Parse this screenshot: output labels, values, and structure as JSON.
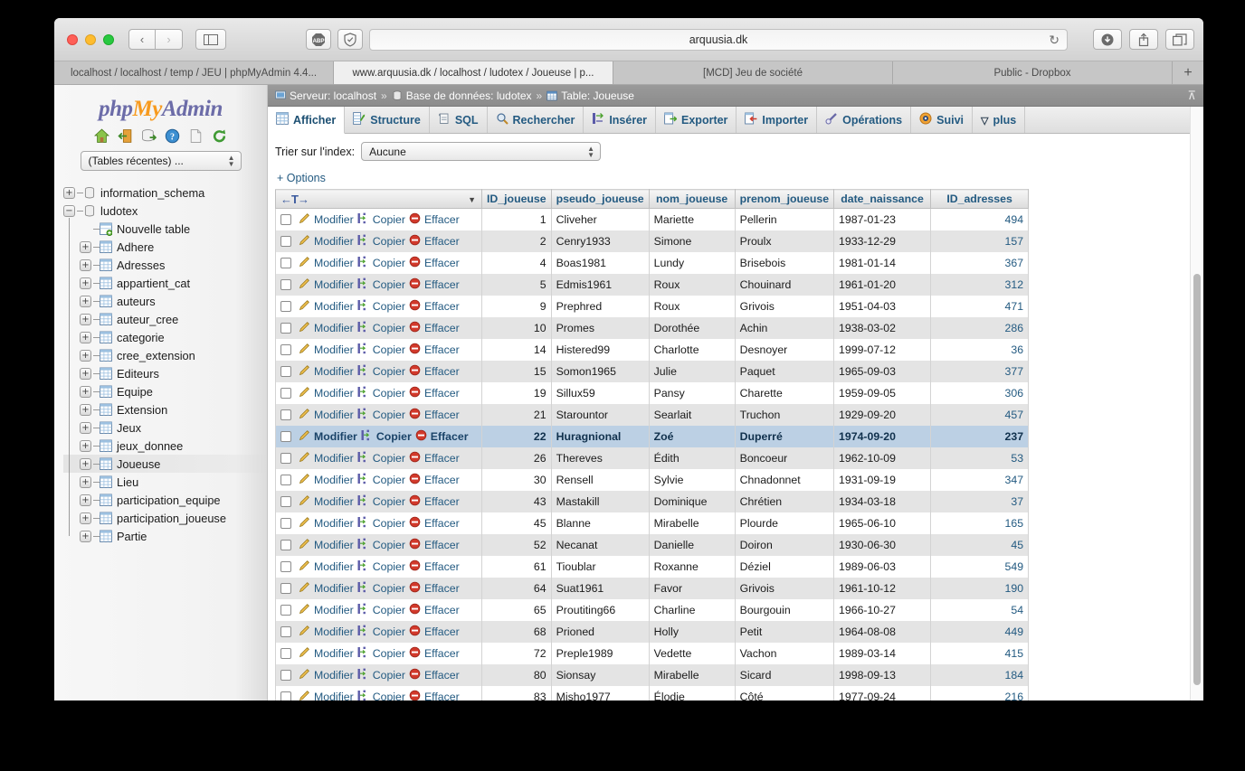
{
  "browser": {
    "address": "arquusia.dk",
    "reload_glyph": "↻",
    "back_glyph": "‹",
    "forward_glyph": "›",
    "sidebar_glyph": "▢",
    "abp_label": "ABP",
    "tabs": [
      {
        "label": "localhost / localhost / temp / JEU | phpMyAdmin 4.4...",
        "active": false
      },
      {
        "label": "www.arquusia.dk / localhost / ludotex / Joueuse | p...",
        "active": true
      },
      {
        "label": "[MCD] Jeu de société",
        "active": false
      },
      {
        "label": "Public - Dropbox",
        "active": false
      }
    ],
    "new_tab_glyph": "+"
  },
  "sidebar": {
    "logo": {
      "php": "php",
      "my": "My",
      "admin": "Admin"
    },
    "icons": [
      "home-icon",
      "logout-icon",
      "export-database-icon",
      "help-icon",
      "documentation-icon",
      "reload-icon"
    ],
    "recent_tables_label": "(Tables récentes) ...",
    "tree": [
      {
        "label": "information_schema",
        "type": "database",
        "expander": "+",
        "indent": 0,
        "selected": false
      },
      {
        "label": "ludotex",
        "type": "database",
        "expander": "−",
        "indent": 0,
        "selected": false
      },
      {
        "label": "Nouvelle table",
        "type": "new-table",
        "expander": "",
        "indent": 1,
        "selected": false
      },
      {
        "label": "Adhere",
        "type": "table",
        "expander": "+",
        "indent": 1,
        "selected": false
      },
      {
        "label": "Adresses",
        "type": "table",
        "expander": "+",
        "indent": 1,
        "selected": false
      },
      {
        "label": "appartient_cat",
        "type": "table",
        "expander": "+",
        "indent": 1,
        "selected": false
      },
      {
        "label": "auteurs",
        "type": "table",
        "expander": "+",
        "indent": 1,
        "selected": false
      },
      {
        "label": "auteur_cree",
        "type": "table",
        "expander": "+",
        "indent": 1,
        "selected": false
      },
      {
        "label": "categorie",
        "type": "table",
        "expander": "+",
        "indent": 1,
        "selected": false
      },
      {
        "label": "cree_extension",
        "type": "table",
        "expander": "+",
        "indent": 1,
        "selected": false
      },
      {
        "label": "Editeurs",
        "type": "table",
        "expander": "+",
        "indent": 1,
        "selected": false
      },
      {
        "label": "Equipe",
        "type": "table",
        "expander": "+",
        "indent": 1,
        "selected": false
      },
      {
        "label": "Extension",
        "type": "table",
        "expander": "+",
        "indent": 1,
        "selected": false
      },
      {
        "label": "Jeux",
        "type": "table",
        "expander": "+",
        "indent": 1,
        "selected": false
      },
      {
        "label": "jeux_donnee",
        "type": "table",
        "expander": "+",
        "indent": 1,
        "selected": false
      },
      {
        "label": "Joueuse",
        "type": "table",
        "expander": "+",
        "indent": 1,
        "selected": true
      },
      {
        "label": "Lieu",
        "type": "table",
        "expander": "+",
        "indent": 1,
        "selected": false
      },
      {
        "label": "participation_equipe",
        "type": "table",
        "expander": "+",
        "indent": 1,
        "selected": false
      },
      {
        "label": "participation_joueuse",
        "type": "table",
        "expander": "+",
        "indent": 1,
        "selected": false
      },
      {
        "label": "Partie",
        "type": "table",
        "expander": "+",
        "indent": 1,
        "selected": false
      }
    ]
  },
  "breadcrumb": {
    "server_label": "Serveur: localhost",
    "database_label": "Base de données: ludotex",
    "table_label": "Table: Joueuse",
    "separator": "»",
    "collapse_glyph": "⊼"
  },
  "navtabs": [
    {
      "label": "Afficher",
      "icon": "browse-icon",
      "active": true
    },
    {
      "label": "Structure",
      "icon": "structure-icon",
      "active": false
    },
    {
      "label": "SQL",
      "icon": "sql-icon",
      "active": false
    },
    {
      "label": "Rechercher",
      "icon": "search-icon",
      "active": false
    },
    {
      "label": "Insérer",
      "icon": "insert-icon",
      "active": false
    },
    {
      "label": "Exporter",
      "icon": "export-icon",
      "active": false
    },
    {
      "label": "Importer",
      "icon": "import-icon",
      "active": false
    },
    {
      "label": "Opérations",
      "icon": "operations-icon",
      "active": false
    },
    {
      "label": "Suivi",
      "icon": "tracking-icon",
      "active": false
    },
    {
      "label": "plus",
      "icon": "chevron-down-icon",
      "active": false
    }
  ],
  "toolbar": {
    "sort_index_label": "Trier sur l'index:",
    "sort_index_value": "Aucune",
    "options_label": "+ Options"
  },
  "table": {
    "action_labels": {
      "edit": "Modifier",
      "copy": "Copier",
      "delete": "Effacer"
    },
    "sort_header_glyph": "←T→",
    "sort_header_arrow": "▼",
    "columns": [
      "ID_joueuse",
      "pseudo_joueuse",
      "nom_joueuse",
      "prenom_joueuse",
      "date_naissance",
      "ID_adresses"
    ],
    "rows": [
      {
        "id": "1",
        "pseudo": "Cliveher",
        "nom": "Mariette",
        "prenom": "Pellerin",
        "date": "1987-01-23",
        "adr": "494",
        "highlight": false
      },
      {
        "id": "2",
        "pseudo": "Cenry1933",
        "nom": "Simone",
        "prenom": "Proulx",
        "date": "1933-12-29",
        "adr": "157",
        "highlight": false
      },
      {
        "id": "4",
        "pseudo": "Boas1981",
        "nom": "Lundy",
        "prenom": "Brisebois",
        "date": "1981-01-14",
        "adr": "367",
        "highlight": false
      },
      {
        "id": "5",
        "pseudo": "Edmis1961",
        "nom": "Roux",
        "prenom": "Chouinard",
        "date": "1961-01-20",
        "adr": "312",
        "highlight": false
      },
      {
        "id": "9",
        "pseudo": "Prephred",
        "nom": "Roux",
        "prenom": "Grivois",
        "date": "1951-04-03",
        "adr": "471",
        "highlight": false
      },
      {
        "id": "10",
        "pseudo": "Promes",
        "nom": "Dorothée",
        "prenom": "Achin",
        "date": "1938-03-02",
        "adr": "286",
        "highlight": false
      },
      {
        "id": "14",
        "pseudo": "Histered99",
        "nom": "Charlotte",
        "prenom": "Desnoyer",
        "date": "1999-07-12",
        "adr": "36",
        "highlight": false
      },
      {
        "id": "15",
        "pseudo": "Somon1965",
        "nom": "Julie",
        "prenom": "Paquet",
        "date": "1965-09-03",
        "adr": "377",
        "highlight": false
      },
      {
        "id": "19",
        "pseudo": "Sillux59",
        "nom": "Pansy",
        "prenom": "Charette",
        "date": "1959-09-05",
        "adr": "306",
        "highlight": false
      },
      {
        "id": "21",
        "pseudo": "Starountor",
        "nom": "Searlait",
        "prenom": "Truchon",
        "date": "1929-09-20",
        "adr": "457",
        "highlight": false
      },
      {
        "id": "22",
        "pseudo": "Huragnional",
        "nom": "Zoé",
        "prenom": "Duperré",
        "date": "1974-09-20",
        "adr": "237",
        "highlight": true
      },
      {
        "id": "26",
        "pseudo": "Thereves",
        "nom": "Édith",
        "prenom": "Boncoeur",
        "date": "1962-10-09",
        "adr": "53",
        "highlight": false
      },
      {
        "id": "30",
        "pseudo": "Rensell",
        "nom": "Sylvie",
        "prenom": "Chnadonnet",
        "date": "1931-09-19",
        "adr": "347",
        "highlight": false
      },
      {
        "id": "43",
        "pseudo": "Mastakill",
        "nom": "Dominique",
        "prenom": "Chrétien",
        "date": "1934-03-18",
        "adr": "37",
        "highlight": false
      },
      {
        "id": "45",
        "pseudo": "Blanne",
        "nom": "Mirabelle",
        "prenom": "Plourde",
        "date": "1965-06-10",
        "adr": "165",
        "highlight": false
      },
      {
        "id": "52",
        "pseudo": "Necanat",
        "nom": "Danielle",
        "prenom": "Doiron",
        "date": "1930-06-30",
        "adr": "45",
        "highlight": false
      },
      {
        "id": "61",
        "pseudo": "Tioublar",
        "nom": "Roxanne",
        "prenom": "Déziel",
        "date": "1989-06-03",
        "adr": "549",
        "highlight": false
      },
      {
        "id": "64",
        "pseudo": "Suat1961",
        "nom": "Favor",
        "prenom": "Grivois",
        "date": "1961-10-12",
        "adr": "190",
        "highlight": false
      },
      {
        "id": "65",
        "pseudo": "Proutiting66",
        "nom": "Charline",
        "prenom": "Bourgouin",
        "date": "1966-10-27",
        "adr": "54",
        "highlight": false
      },
      {
        "id": "68",
        "pseudo": "Prioned",
        "nom": "Holly",
        "prenom": "Petit",
        "date": "1964-08-08",
        "adr": "449",
        "highlight": false
      },
      {
        "id": "72",
        "pseudo": "Preple1989",
        "nom": "Vedette",
        "prenom": "Vachon",
        "date": "1989-03-14",
        "adr": "415",
        "highlight": false
      },
      {
        "id": "80",
        "pseudo": "Sionsay",
        "nom": "Mirabelle",
        "prenom": "Sicard",
        "date": "1998-09-13",
        "adr": "184",
        "highlight": false
      },
      {
        "id": "83",
        "pseudo": "Misho1977",
        "nom": "Élodie",
        "prenom": "Côté",
        "date": "1977-09-24",
        "adr": "216",
        "highlight": false
      }
    ]
  },
  "colors": {
    "link": "#235a81",
    "highlight_row": "#bcd0e4",
    "even_row": "#e4e4e4",
    "breadcrumb_bg": "#8c8c8c"
  }
}
